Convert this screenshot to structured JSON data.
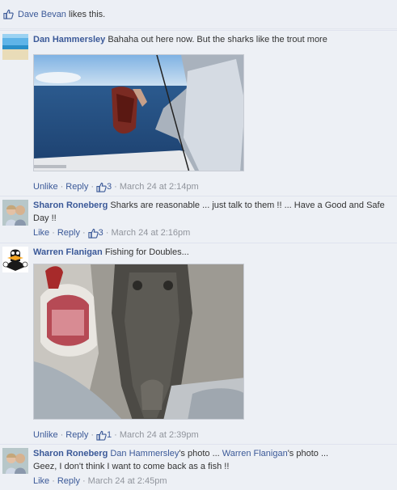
{
  "likes": {
    "name": "Dave Bevan",
    "suffix": "likes this."
  },
  "comments": [
    {
      "author": "Dan Hammersley",
      "text": "Bahaha out here now. But the sharks like the trout more",
      "actions": {
        "unlike": "Unlike",
        "reply": "Reply",
        "likes": "3",
        "time": "March 24 at 2:14pm"
      },
      "avatar_icon": "beach-avatar",
      "photo": "shark-head-on-boat-photo"
    },
    {
      "author": "Sharon Roneberg",
      "text": "Sharks are reasonable ... just talk to them !! ... Have a Good and Safe Day !!",
      "actions": {
        "like": "Like",
        "reply": "Reply",
        "likes": "3",
        "time": "March 24 at 2:16pm"
      },
      "avatar_icon": "couple-avatar"
    },
    {
      "author": "Warren Flanigan",
      "text": "Fishing for Doubles...",
      "actions": {
        "unlike": "Unlike",
        "reply": "Reply",
        "likes": "1",
        "time": "March 24 at 2:39pm"
      },
      "avatar_icon": "cartoon-duck-avatar",
      "photo": "crocodile-eating-fish-photo"
    },
    {
      "author": "Sharon Roneberg",
      "mention1": "Dan Hammersley",
      "mid1": "'s photo ... ",
      "mention2": "Warren Flanigan",
      "mid2": "'s photo ...",
      "text2": "Geez, I don't think I want to come back as a fish !!",
      "actions": {
        "like": "Like",
        "reply": "Reply",
        "time": "March 24 at 2:45pm"
      },
      "avatar_icon": "couple-avatar"
    }
  ],
  "colors": {
    "link": "#3b5998",
    "panel": "#edf0f5",
    "meta": "#90949c"
  }
}
